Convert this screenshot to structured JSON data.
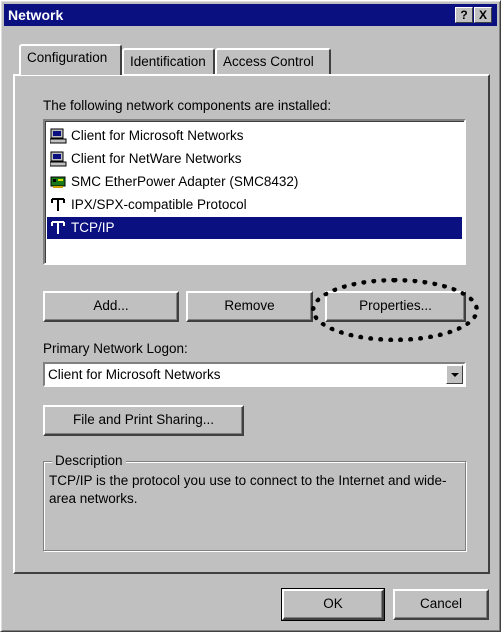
{
  "window": {
    "title": "Network",
    "help_glyph": "?",
    "close_glyph": "X"
  },
  "tabs": [
    {
      "label": "Configuration",
      "active": true
    },
    {
      "label": "Identification",
      "active": false
    },
    {
      "label": "Access Control",
      "active": false
    }
  ],
  "components": {
    "label": "The following network components are installed:",
    "items": [
      {
        "label": "Client for Microsoft Networks",
        "icon": "client-icon",
        "selected": false
      },
      {
        "label": "Client for NetWare Networks",
        "icon": "client-icon",
        "selected": false
      },
      {
        "label": "SMC EtherPower Adapter (SMC8432)",
        "icon": "adapter-icon",
        "selected": false
      },
      {
        "label": "IPX/SPX-compatible Protocol",
        "icon": "protocol-icon",
        "selected": false
      },
      {
        "label": "TCP/IP",
        "icon": "protocol-icon",
        "selected": true
      }
    ]
  },
  "buttons": {
    "add": "Add...",
    "remove": "Remove",
    "properties": "Properties...",
    "file_print": "File and Print Sharing...",
    "ok": "OK",
    "cancel": "Cancel"
  },
  "logon": {
    "label": "Primary Network Logon:",
    "value": "Client for Microsoft Networks"
  },
  "description": {
    "legend": "Description",
    "text": "TCP/IP is the protocol you use to connect to the Internet and wide-area networks."
  },
  "colors": {
    "selection": "#0a1080",
    "face": "#c0c0c0"
  }
}
